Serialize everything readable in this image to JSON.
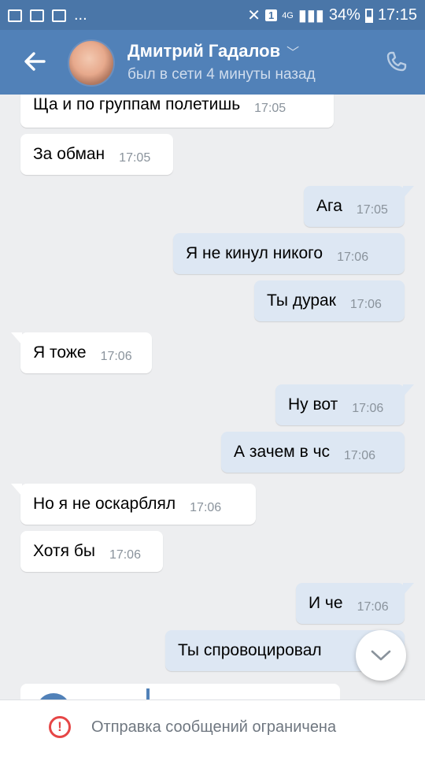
{
  "status_bar": {
    "left_icons": [
      "broom-icon",
      "image-icon",
      "broom-icon"
    ],
    "dots": "...",
    "sim_badge": "1",
    "network": "4G",
    "battery": "34%",
    "time": "17:15"
  },
  "header": {
    "name": "Дмитрий Гадалов",
    "status": "был в сети 4 минуты назад"
  },
  "messages": [
    {
      "text": "Ща и по группам полетишь",
      "time": "17:05",
      "dir": "in"
    },
    {
      "text": "За обман",
      "time": "17:05",
      "dir": "in"
    },
    {
      "text": "Ага",
      "time": "17:05",
      "dir": "out"
    },
    {
      "text": "Я не кинул никого",
      "time": "17:06",
      "dir": "out"
    },
    {
      "text": "Ты дурак",
      "time": "17:06",
      "dir": "out"
    },
    {
      "text": "Я тоже",
      "time": "17:06",
      "dir": "in"
    },
    {
      "text": "Ну вот",
      "time": "17:06",
      "dir": "out"
    },
    {
      "text": "А зачем в чс",
      "time": "17:06",
      "dir": "out"
    },
    {
      "text": "Но я не оскарблял",
      "time": "17:06",
      "dir": "in"
    },
    {
      "text": "Хотя бы",
      "time": "17:06",
      "dir": "in"
    },
    {
      "text": "И че",
      "time": "17:06",
      "dir": "out"
    },
    {
      "text": "Ты спровоцировал",
      "time": "",
      "dir": "out"
    }
  ],
  "bottom": {
    "icon": "!",
    "text": "Отправка сообщений ограничена"
  }
}
